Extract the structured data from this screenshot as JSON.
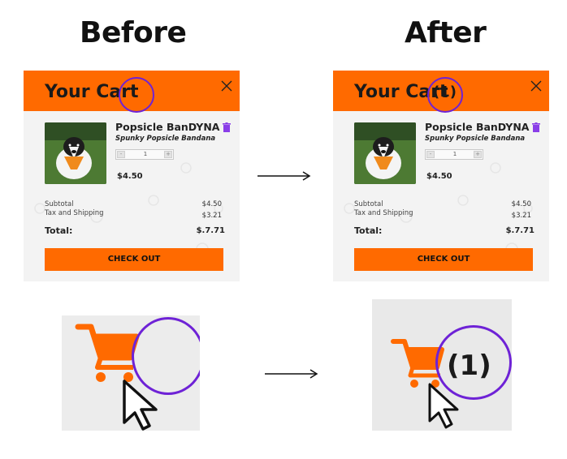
{
  "headings": {
    "before": "Before",
    "after": "After"
  },
  "cart": {
    "title": "Your Cart",
    "item_name": "Popsicle BanDYNA",
    "item_subtitle": "Spunky Popsicle Bandana",
    "quantity": "1",
    "decrement_label": "-",
    "increment_label": "+",
    "item_price": "$4.50",
    "subtotal_label": "Subtotal",
    "subtotal_value": "$4.50",
    "tax_label": "Tax and Shipping",
    "tax_value": "$3.21",
    "total_label": "Total:",
    "total_value": "$.7.71",
    "checkout_label": "CHECK OUT"
  },
  "after_state": {
    "cart_count": "(1)"
  },
  "colors": {
    "brand_orange": "#ff6a00",
    "highlight_ring": "#6e22d6"
  },
  "icons": [
    "close-icon",
    "trash-icon",
    "cart-icon",
    "cursor-icon",
    "arrow-right-icon"
  ]
}
